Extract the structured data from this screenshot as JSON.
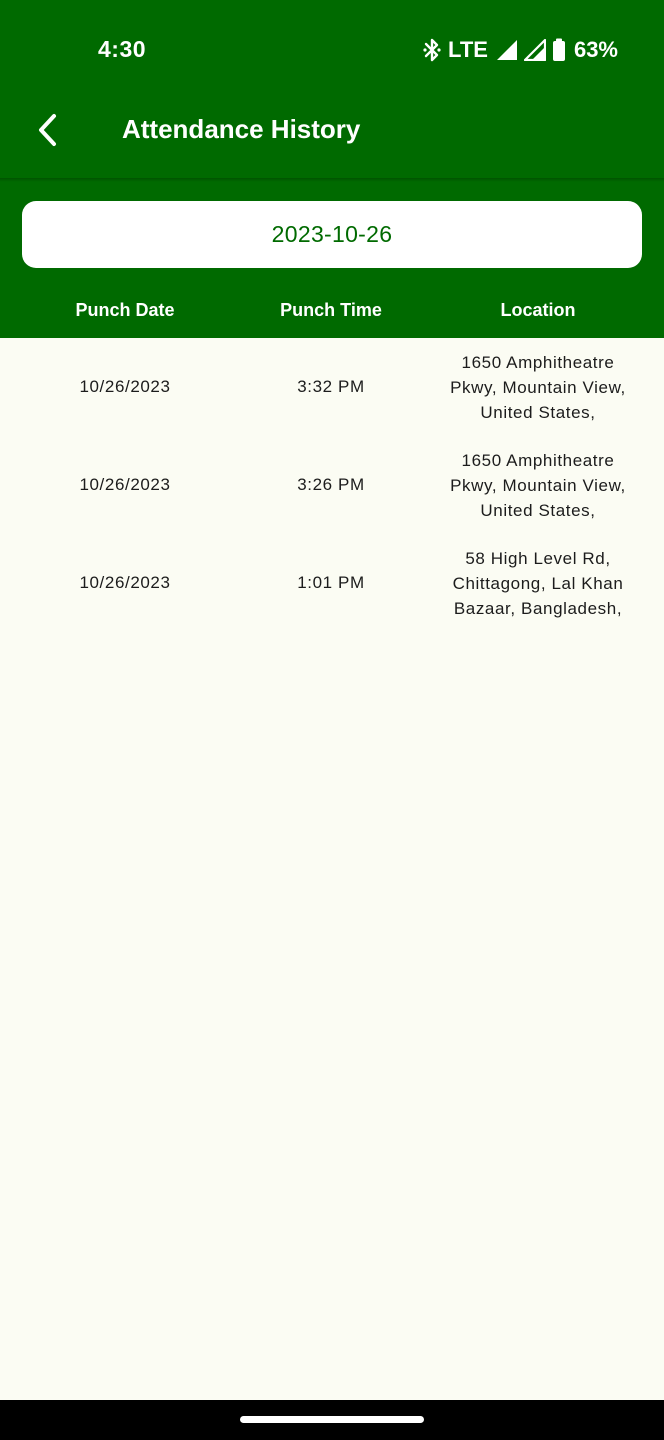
{
  "status_bar": {
    "time": "4:30",
    "network": "LTE",
    "battery": "63%",
    "icons": [
      "bluetooth-icon",
      "signal-icon",
      "signal-icon",
      "battery-icon"
    ]
  },
  "app_bar": {
    "title": "Attendance History",
    "back_icon": "chevron-left-icon"
  },
  "date_selector": {
    "value": "2023-10-26"
  },
  "table": {
    "headers": [
      "Punch Date",
      "Punch Time",
      "Location"
    ],
    "rows": [
      {
        "date": "10/26/2023",
        "time": "3:32 PM",
        "location": "1650 Amphitheatre Pkwy, Mountain View, United States,"
      },
      {
        "date": "10/26/2023",
        "time": "3:26 PM",
        "location": "1650 Amphitheatre Pkwy, Mountain View, United States,"
      },
      {
        "date": "10/26/2023",
        "time": "1:01 PM",
        "location": "58 High Level Rd, Chittagong, Lal Khan Bazaar, Bangladesh,"
      }
    ]
  },
  "colors": {
    "primary": "#006A00",
    "background": "#FBFCF3",
    "text": "#1C1C1C",
    "on_primary": "#FFFFFF"
  }
}
